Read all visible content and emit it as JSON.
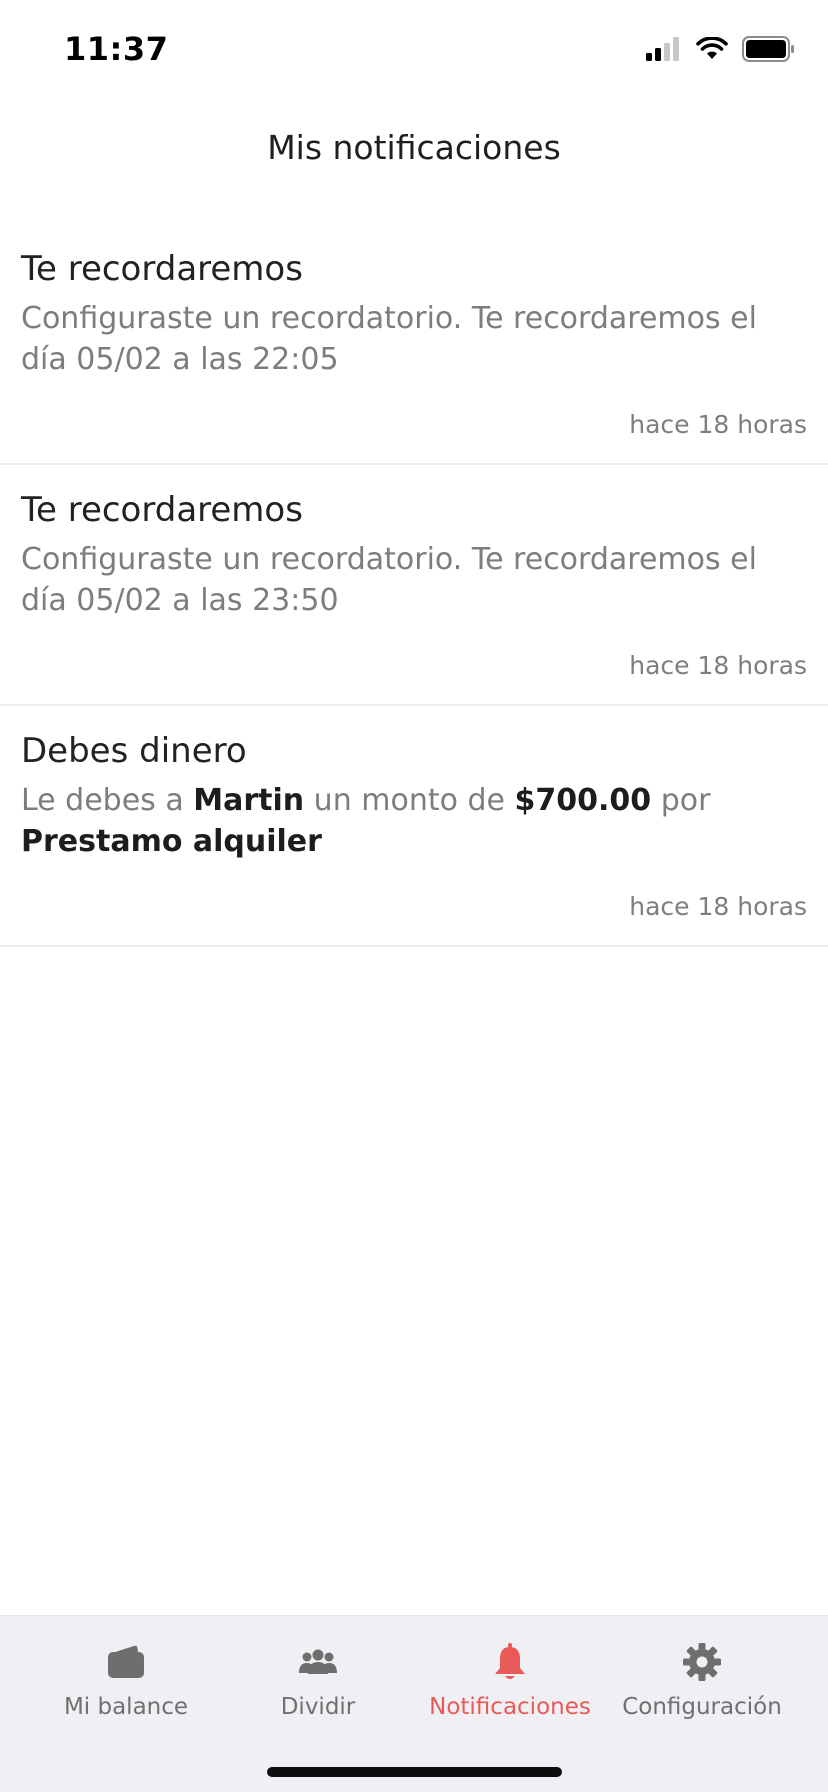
{
  "status_bar": {
    "time": "11:37"
  },
  "header": {
    "title": "Mis notificaciones"
  },
  "notifications": [
    {
      "title": "Te recordaremos",
      "body": "Configuraste un recordatorio. Te recordaremos el día 05/02 a las 22:05",
      "time": "hace 18 horas"
    },
    {
      "title": "Te recordaremos",
      "body": "Configuraste un recordatorio. Te recordaremos el día 05/02 a las 23:50",
      "time": "hace 18 horas"
    },
    {
      "title": "Debes dinero",
      "body_parts": [
        "Le debes a ",
        "Martin",
        " un monto de ",
        "$700.00",
        " por ",
        "Prestamo alquiler"
      ],
      "time": "hace 18 horas"
    }
  ],
  "tab_bar": {
    "tabs": [
      {
        "label": "Mi balance",
        "icon": "wallet-icon"
      },
      {
        "label": "Dividir",
        "icon": "group-icon"
      },
      {
        "label": "Notificaciones",
        "icon": "bell-icon",
        "active": true
      },
      {
        "label": "Configuración",
        "icon": "gear-icon"
      }
    ],
    "active_color": "#e85a57",
    "inactive_color": "#707070"
  }
}
